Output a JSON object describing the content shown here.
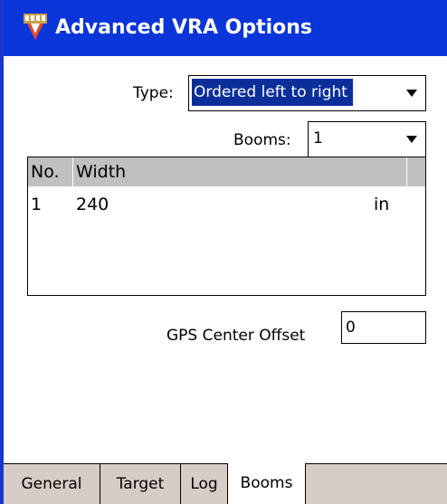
{
  "window": {
    "title": "Advanced VRA Options"
  },
  "type_field": {
    "label": "Type:",
    "value": "Ordered left to right"
  },
  "booms_field": {
    "label": "Booms:",
    "value": "1"
  },
  "boom_table": {
    "columns": [
      "No.",
      "Width",
      ""
    ],
    "rows": [
      {
        "no": "1",
        "width": "240",
        "unit": "in"
      }
    ]
  },
  "gps_offset": {
    "label": "GPS Center Offset",
    "value": "0"
  },
  "tabs": [
    {
      "label": "General",
      "active": false
    },
    {
      "label": "Target",
      "active": false
    },
    {
      "label": "Log",
      "active": false
    },
    {
      "label": "Booms",
      "active": true
    }
  ],
  "colors": {
    "titlebar": "#0a35d8",
    "selection": "#0a2f9a",
    "tabbar": "#d8ccc6",
    "table_header": "#c0c0c0"
  }
}
